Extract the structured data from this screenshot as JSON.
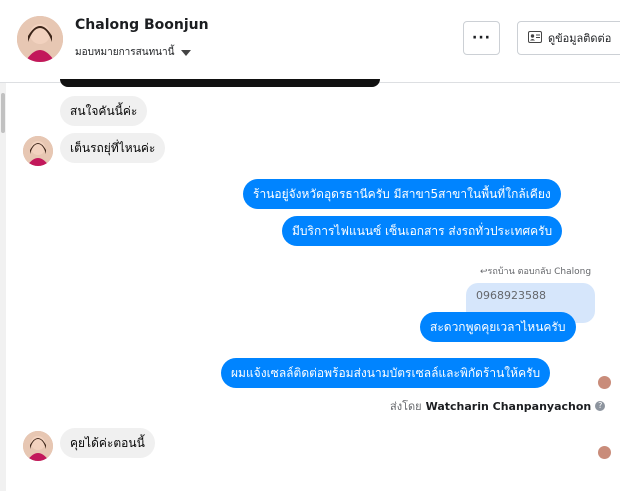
{
  "header": {
    "name": "Chalong Boonjun",
    "assign_label": "มอบหมายการสนทนานี้",
    "more_label": "···",
    "info_label": "ดูข้อมูลติดต่อ"
  },
  "messages": {
    "m1": "สนใจคันนี้ค่ะ",
    "m2": "เต็นรถยุ่ที่ไหนค่ะ",
    "m3": "ร้านอยู่จังหวัดอุดรธานีครับ มีสาขา5สาขาในพื้นที่ใกล้เคียง",
    "m4": "มีบริการไฟแนนซ์ เซ็นเอกสาร ส่งรถทั่วประเทศครับ",
    "reply_label": "รถบ้าน ตอบกลับ Chalong",
    "reply_quote": "0968923588",
    "m5": "สะดวกพูดคุยเวลาไหนครับ",
    "m6": "ผมแจ้งเซลล์ติดต่อพร้อมส่งนามบัตรเซลล์และพิกัดร้านให้ครับ",
    "sent_by_prefix": "ส่งโดย",
    "sent_by_name": "Watcharin Chanpanyachon",
    "m7": "คุยได้ค่ะตอนนี้"
  },
  "colors": {
    "outgoing": "#0084ff",
    "incoming": "#f0f0f0"
  },
  "icons": {
    "more": "more-horizontal-icon",
    "info": "contact-card-icon",
    "help": "help-icon",
    "reply": "reply-icon"
  }
}
